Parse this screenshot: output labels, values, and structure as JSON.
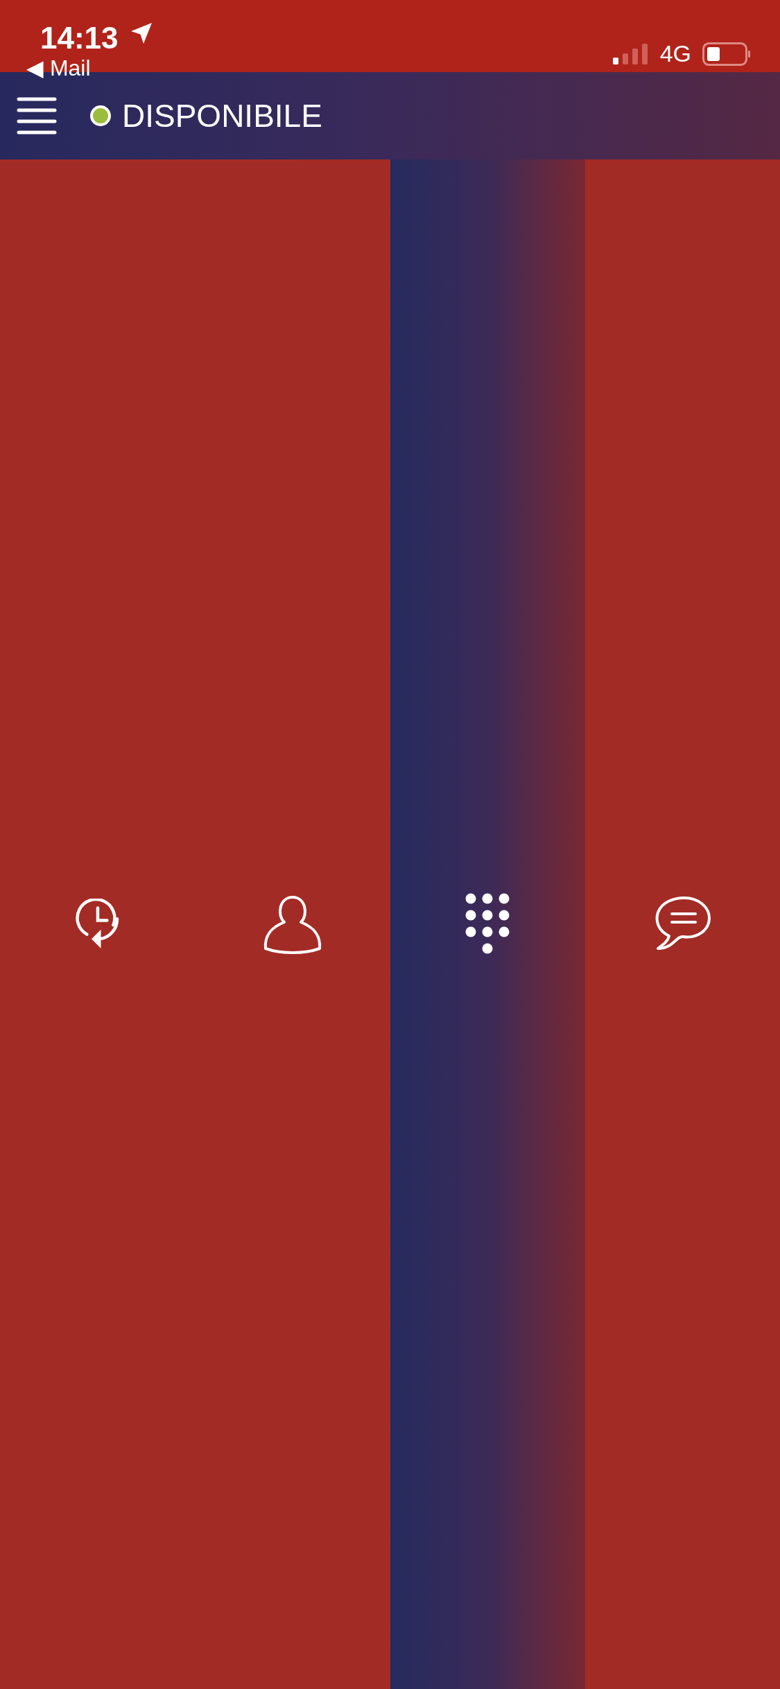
{
  "status_bar": {
    "time": "14:13",
    "back_link": "◀ Mail",
    "network": "4G"
  },
  "header": {
    "status": "DISPONIBILE"
  },
  "tabs": [
    {
      "kind": "history",
      "selected": false
    },
    {
      "kind": "contact",
      "selected": false
    },
    {
      "kind": "keypad",
      "selected": true
    },
    {
      "kind": "chat",
      "selected": false
    }
  ]
}
